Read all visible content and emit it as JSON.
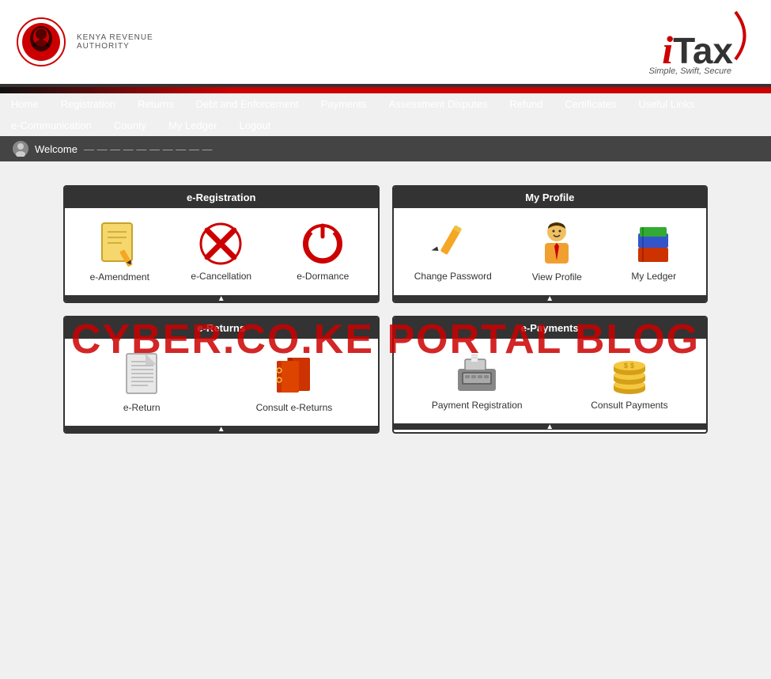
{
  "header": {
    "kra_name_line1": "Kenya Revenue",
    "kra_name_line2": "Authority",
    "itax_tagline": "Simple, Swift, Secure"
  },
  "nav": {
    "row1": [
      {
        "label": "Home",
        "id": "home"
      },
      {
        "label": "Registration",
        "id": "registration"
      },
      {
        "label": "Returns",
        "id": "returns"
      },
      {
        "label": "Debt and Enforcement",
        "id": "debt"
      },
      {
        "label": "Payments",
        "id": "payments"
      },
      {
        "label": "Assessment Disputes",
        "id": "assessment"
      },
      {
        "label": "Refund",
        "id": "refund"
      },
      {
        "label": "Certificates",
        "id": "certificates"
      },
      {
        "label": "Useful Links",
        "id": "useful"
      }
    ],
    "row2": [
      {
        "label": "e-Communication",
        "id": "ecomm"
      },
      {
        "label": "County",
        "id": "county"
      },
      {
        "label": "My Ledger",
        "id": "ledger"
      },
      {
        "label": "Logout",
        "id": "logout"
      }
    ]
  },
  "welcome": {
    "text": "Welcome"
  },
  "cards": {
    "registration": {
      "title": "e-Registration",
      "items": [
        {
          "label": "e-Amendment",
          "icon": "amendment"
        },
        {
          "label": "e-Cancellation",
          "icon": "cancel"
        },
        {
          "label": "e-Dormance",
          "icon": "dormance"
        }
      ]
    },
    "profile": {
      "title": "My Profile",
      "items": [
        {
          "label": "Change Password",
          "icon": "password"
        },
        {
          "label": "View Profile",
          "icon": "profile"
        },
        {
          "label": "My Ledger",
          "icon": "ledger"
        }
      ]
    },
    "returns": {
      "title": "e-Returns",
      "items": [
        {
          "label": "e-Return",
          "icon": "return"
        },
        {
          "label": "Consult e-Returns",
          "icon": "consult-returns"
        }
      ]
    },
    "payments": {
      "title": "e-Payments",
      "items": [
        {
          "label": "Payment Registration",
          "icon": "payment"
        },
        {
          "label": "Consult Payments",
          "icon": "consult-payments"
        }
      ]
    }
  },
  "watermark": "CYBER.CO.KE PORTAL BLOG"
}
